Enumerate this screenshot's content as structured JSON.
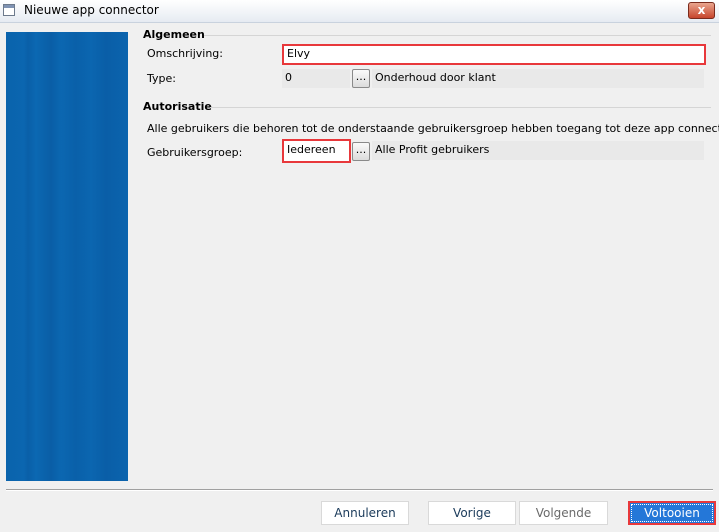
{
  "window": {
    "title": "Nieuwe app connector",
    "close_glyph": "x"
  },
  "colors": {
    "side_panel": "#0a63ac",
    "highlight_border": "#e8383b",
    "primary_button": "#2477d8"
  },
  "algemeen": {
    "heading": "Algemeen",
    "omschrijving_label": "Omschrijving:",
    "omschrijving_value": "Elvy",
    "type_label": "Type:",
    "type_code": "0",
    "type_description": "Onderhoud door klant",
    "type_lookup_label": "..."
  },
  "autorisatie": {
    "heading": "Autorisatie",
    "description": "Alle gebruikers die behoren tot de onderstaande gebruikersgroep hebben toegang tot deze app connector.",
    "groep_label": "Gebruikersgroep:",
    "groep_value": "Iedereen",
    "groep_description": "Alle Profit gebruikers",
    "groep_lookup_label": "..."
  },
  "buttons": {
    "annuleren": "Annuleren",
    "vorige": "Vorige",
    "volgende": "Volgende",
    "voltooien": "Voltooien"
  }
}
